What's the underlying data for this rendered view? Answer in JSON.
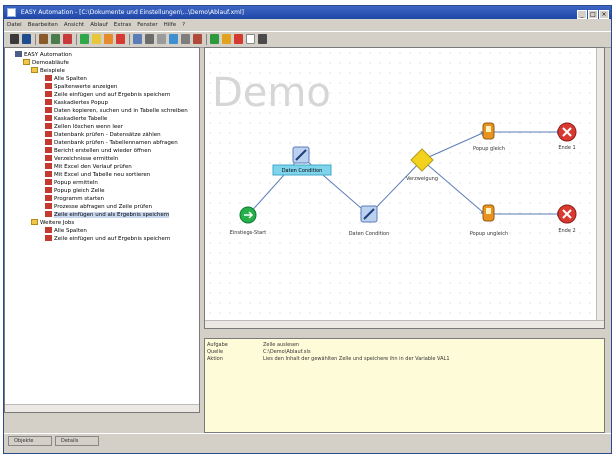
{
  "window": {
    "title": "EASY Automation - [C:\\Dokumente und Einstellungen\\...\\Demo\\Ablauf.xml]"
  },
  "menu": [
    "Datei",
    "Bearbeiten",
    "Ansicht",
    "Ablauf",
    "Extras",
    "Fenster",
    "Hilfe",
    "?"
  ],
  "tree": {
    "root": "EASY Automation",
    "group": "Demoabläufe",
    "folder1": "Beispiele",
    "items": [
      "Alle Spalten",
      "Spaltenwerte anzeigen",
      "Zeile einfügen und auf Ergebnis speichern",
      "Kaskadiertes Popup",
      "Daten kopieren, suchen und in Tabelle schreiben",
      "Kaskadierte Tabelle",
      "Zellen löschen wenn leer",
      "Datenbank prüfen - Datensätze zählen",
      "Datenbank prüfen - Tabellennamen abfragen",
      "Bericht erstellen und wieder öffnen",
      "Verzeichnisse ermitteln",
      "Mit Excel den Verlauf prüfen",
      "Mit Excel und Tabelle neu sortieren",
      "Popup ermitteln",
      "Popup gleich Zelle",
      "Programm starten",
      "Prozesse abfragen und Zeile prüfen",
      "Zeile einfügen und als Ergebnis speichern"
    ],
    "selected_index": 17,
    "folder2": "Weitere Jobs",
    "items2": [
      "Alle Spalten",
      "Zeile einfügen und auf Ergebnis speichern"
    ]
  },
  "canvas": {
    "watermark": "Demo",
    "nodes": {
      "start": "Einstiegs-Start",
      "c1": "Daten Condition",
      "c2": "Daten Condition",
      "decision": "Verzweigung",
      "p1": "Popup gleich",
      "p2": "Popup ungleich",
      "e1": "Ende 1",
      "e2": "Ende 2"
    }
  },
  "properties": [
    {
      "key": "Aufgabe",
      "value": "Zelle auslesen"
    },
    {
      "key": "Quelle",
      "value": "C:\\Demo\\Ablauf.xls"
    },
    {
      "key": "Aktion",
      "value": "Lies den Inhalt der gewählten Zelle und speichere ihn in der Variable VAL1"
    }
  ],
  "status": {
    "tab1": "Objekte",
    "tab2": "Details"
  },
  "colors": {
    "titlebar": "#2a53b8",
    "selection": "#c9d7ef",
    "properties_bg": "#fefbd9",
    "start_node": "#25b04a",
    "end_node": "#d83a31",
    "decision_node": "#f3d21e"
  }
}
